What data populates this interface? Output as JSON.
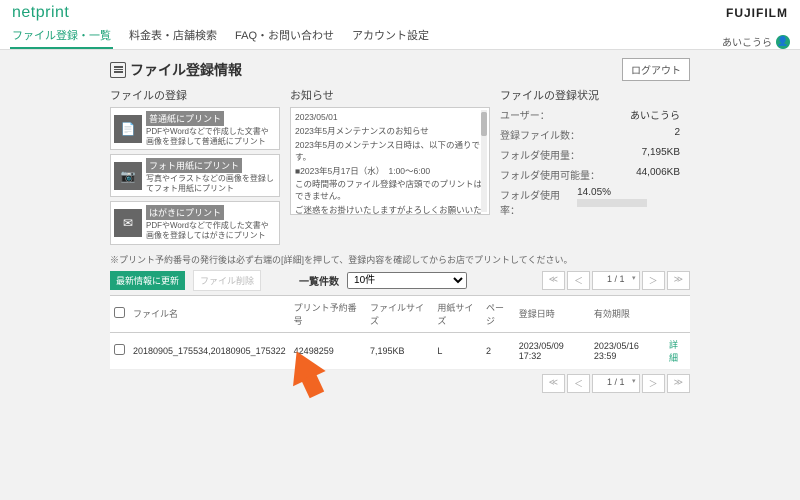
{
  "header": {
    "logo": "netprint",
    "brand": "FUJIFILM"
  },
  "tabs": {
    "items": [
      "ファイル登録・一覧",
      "料金表・店舗検索",
      "FAQ・お問い合わせ",
      "アカウント設定"
    ],
    "active_index": 0
  },
  "user": {
    "name": "あいこうら"
  },
  "page_title": "ファイル登録情報",
  "logout_label": "ログアウト",
  "panel_titles": {
    "register": "ファイルの登録",
    "notices": "お知らせ",
    "status": "ファイルの登録状況"
  },
  "register_cards": [
    {
      "title": "普通紙にプリント",
      "desc": "PDFやWordなどで作成した文書や画像を登録して普通紙にプリント"
    },
    {
      "title": "フォト用紙にプリント",
      "desc": "写真やイラストなどの画像を登録してフォト用紙にプリント"
    },
    {
      "title": "はがきにプリント",
      "desc": "PDFやWordなどで作成した文書や画像を登録してはがきにプリント"
    }
  ],
  "notices": {
    "date": "2023/05/01",
    "headline": "2023年5月メンテナンスのお知らせ",
    "line1": "2023年5月のメンテナンス日時は、以下の通りです。",
    "line2": "■2023年5月17日（水）　1:00～6:00",
    "line3": "この時間帯のファイル登録や店頭でのプリントはできません。",
    "line4": "ご迷惑をお掛けいたしますがよろしくお願いいたします。"
  },
  "status": {
    "rows": [
      {
        "label": "ユーザー：",
        "value": "あいこうら"
      },
      {
        "label": "登録ファイル数：",
        "value": "2"
      },
      {
        "label": "フォルダ使用量：",
        "value": "7,195KB"
      },
      {
        "label": "フォルダ使用可能量：",
        "value": "44,006KB"
      },
      {
        "label": "フォルダ使用率：",
        "value": "14.05%"
      }
    ],
    "usage_pct": 14.05
  },
  "note": "※プリント予約番号の発行後は必ず右端の[詳細]を押して、登録内容を確認してからお店でプリントしてください。",
  "actions": {
    "refresh": "最新情報に更新",
    "delete": "ファイル削除"
  },
  "perpage": {
    "label": "一覧件数",
    "selected": "10件"
  },
  "pager": {
    "first": "≪",
    "prev": "＜",
    "current": "1 / 1",
    "next": "＞",
    "last": "≫"
  },
  "table": {
    "headers": [
      "",
      "ファイル名",
      "プリント予約番号",
      "ファイルサイズ",
      "用紙サイズ",
      "ページ",
      "登録日時",
      "有効期限",
      ""
    ],
    "rows": [
      {
        "filename": "20180905_175534,20180905_175322",
        "reservation": "42498259",
        "filesize": "7,195KB",
        "papersize": "L",
        "pages": "2",
        "created": "2023/05/09 17:32",
        "expires": "2023/05/16 23:59",
        "detail": "詳細"
      }
    ]
  }
}
